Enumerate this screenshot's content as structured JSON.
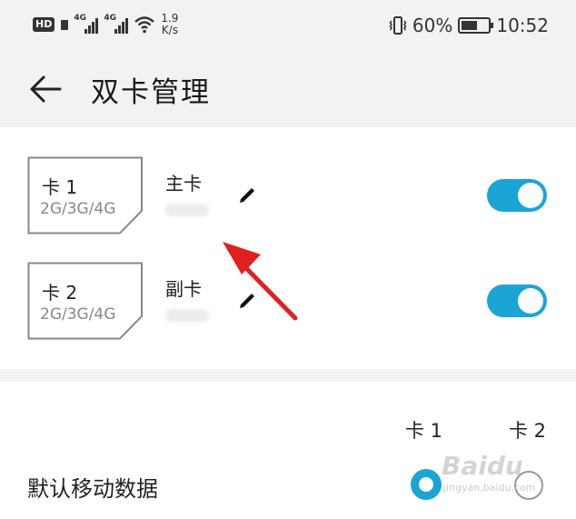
{
  "status_bar": {
    "hd_label": "HD",
    "sim1_network": "4G",
    "sim2_network": "4G",
    "speed_value": "1.9",
    "speed_unit": "K/s",
    "battery_percent": "60%",
    "battery_level": 0.6,
    "time": "10:52",
    "icons": [
      "hd-icon",
      "signal-icon",
      "wifi-icon",
      "vibrate-icon",
      "battery-icon"
    ]
  },
  "app_bar": {
    "title": "双卡管理",
    "back_icon": "back-arrow-icon"
  },
  "sims": [
    {
      "card_label": "卡 1",
      "networks": "2G/3G/4G",
      "name": "主卡",
      "enabled": true
    },
    {
      "card_label": "卡 2",
      "networks": "2G/3G/4G",
      "name": "副卡",
      "enabled": true
    }
  ],
  "mobile_data": {
    "col1": "卡 1",
    "col2": "卡 2",
    "label": "默认移动数据",
    "selected": "卡 1"
  },
  "watermark": {
    "text": "Baidu",
    "sub": "jingyan.baidu.com"
  },
  "colors": {
    "accent": "#1aa5d6",
    "annotation": "#e02020"
  }
}
